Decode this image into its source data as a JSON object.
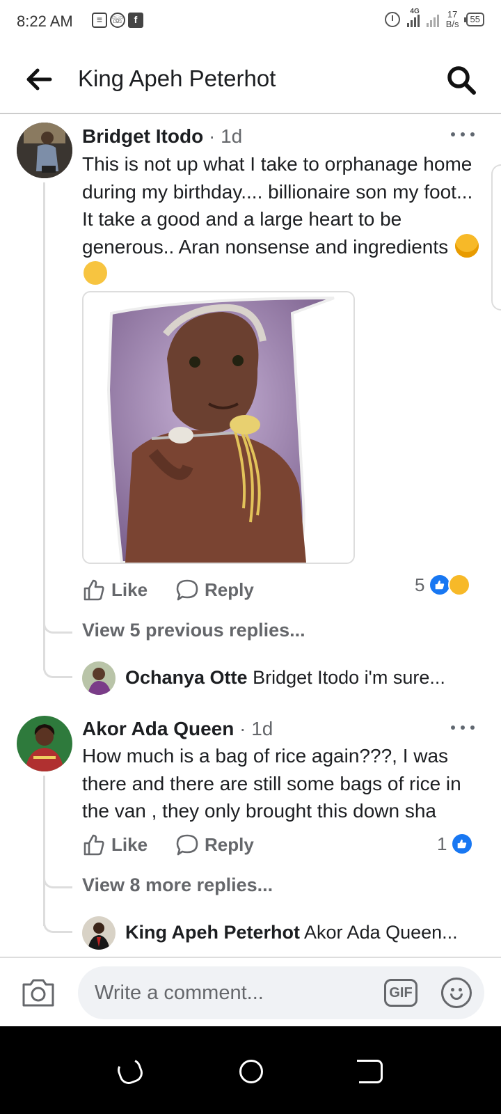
{
  "status_bar": {
    "time": "8:22 AM",
    "network": "4G",
    "speed_value": "17",
    "speed_unit": "B/s",
    "battery": "55"
  },
  "header": {
    "title": "King Apeh Peterhot"
  },
  "comments": [
    {
      "author": "Bridget Itodo",
      "time": "· 1d",
      "text": "This is not up what I take to orphanage home during my birthday.... billionaire son my foot...   It take a good and a large heart to be generous.. Aran nonsense and ingredients",
      "like_label": "Like",
      "reply_label": "Reply",
      "reaction_count": "5",
      "view_replies": "View 5 previous replies...",
      "reply_preview": {
        "author": "Ochanya Otte",
        "text": "Bridget Itodo i'm sure..."
      }
    },
    {
      "author": "Akor Ada Queen",
      "time": "· 1d",
      "text": "How much is a bag of rice again???, I was there and there are still some bags of rice in the van , they only brought this down sha",
      "like_label": "Like",
      "reply_label": "Reply",
      "reaction_count": "1",
      "view_replies": "View 8 more replies...",
      "reply_preview": {
        "author": "King Apeh Peterhot",
        "text": "Akor Ada Queen..."
      }
    }
  ],
  "composer": {
    "placeholder": "Write a comment...",
    "gif_label": "GIF"
  },
  "colors": {
    "accent": "#1877f2",
    "secondary_text": "#65676b"
  }
}
